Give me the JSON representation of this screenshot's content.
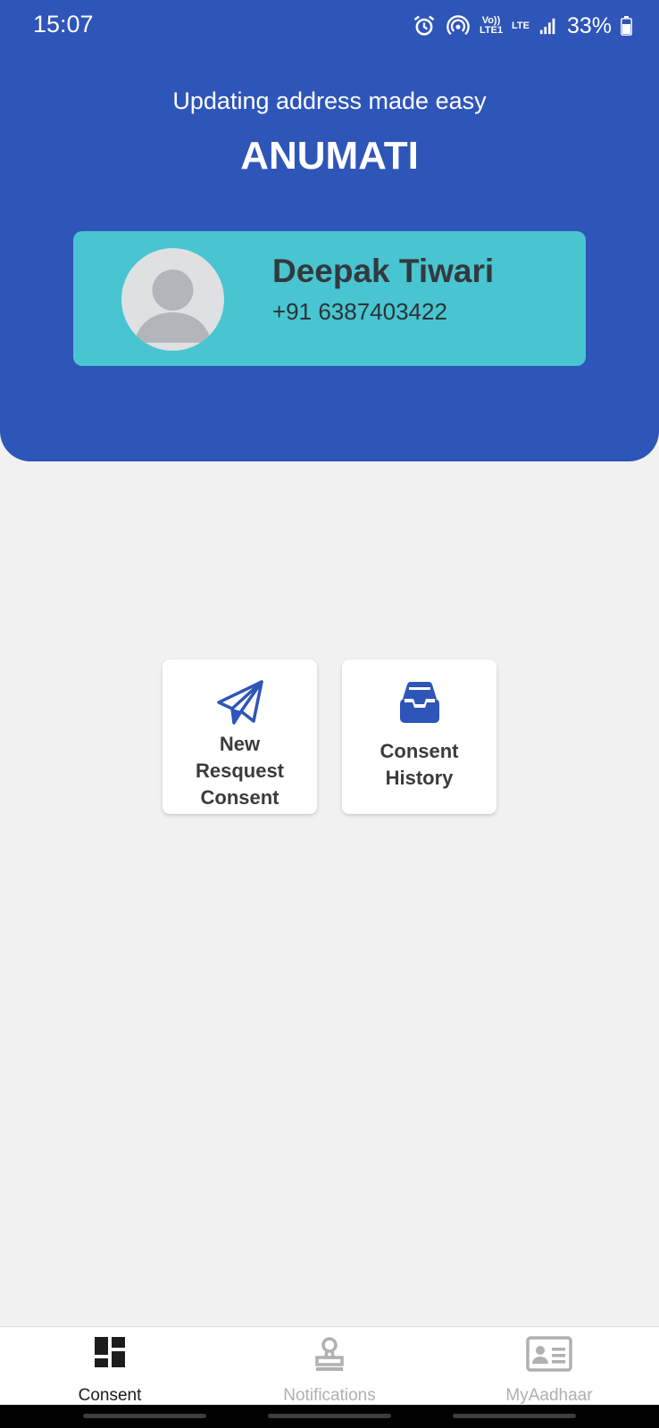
{
  "status_bar": {
    "time": "15:07",
    "icons": [
      "alarm-icon",
      "hotspot-icon",
      "volte-icon",
      "lte-icon",
      "signal-icon"
    ],
    "volte_label": "Vo)) LTE1",
    "lte_label": "LTE",
    "battery": "33%"
  },
  "header": {
    "tagline": "Updating address made easy",
    "title": "ANUMATI",
    "color": "#2e55b8"
  },
  "profile": {
    "name": "Deepak Tiwari",
    "phone": "+91 6387403422",
    "card_color": "#48c5d1"
  },
  "actions": [
    {
      "icon": "paper-plane-icon",
      "label_lines": [
        "New",
        "Resquest",
        "Consent"
      ]
    },
    {
      "icon": "inbox-tray-icon",
      "label_lines": [
        "Consent",
        "History"
      ]
    }
  ],
  "bottom_nav": {
    "items": [
      {
        "label": "Consent",
        "icon": "dashboard-icon",
        "active": true
      },
      {
        "label": "Notifications",
        "icon": "stamp-icon",
        "active": false
      },
      {
        "label": "MyAadhaar",
        "icon": "id-card-icon",
        "active": false
      }
    ],
    "active_color": "#1c1c1c",
    "inactive_color": "#b0b0b0"
  }
}
